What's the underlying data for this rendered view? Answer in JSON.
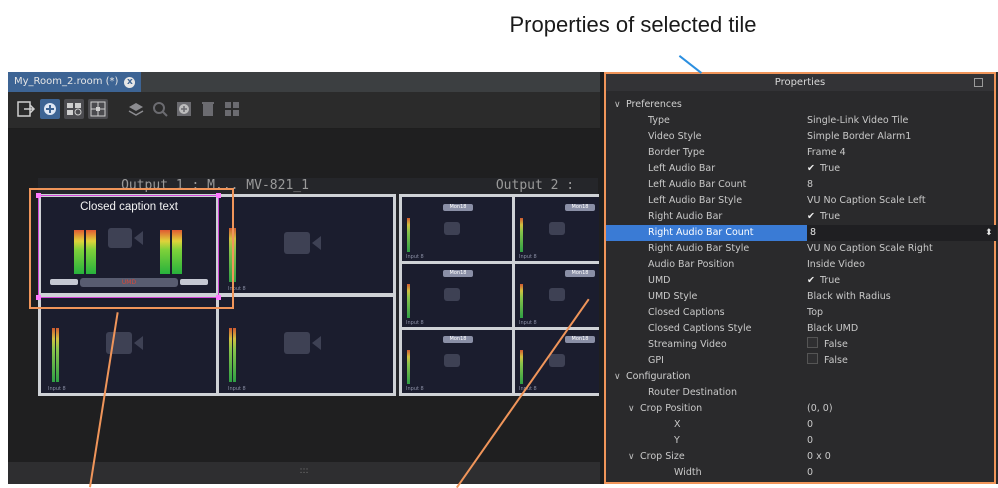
{
  "caption": "Properties of selected tile",
  "tab": {
    "title": "My_Room_2.room (*)",
    "close_glyph": "x"
  },
  "toolbar": {
    "icons": [
      "exit-icon",
      "add-tile-icon",
      "layout-icon",
      "grid-icon",
      "layers-icon",
      "zoom-icon",
      "add-icon",
      "delete-icon",
      "tiles-icon"
    ]
  },
  "canvas": {
    "output1": "Output 1 : M... MV-821_1",
    "output2": "Output 2 :",
    "closed_caption": "Closed caption text",
    "umd_text": "UMD",
    "mon_label": "Mon18",
    "input_label": "Input 8"
  },
  "splitter_glyph": ":::",
  "properties": {
    "title": "Properties",
    "rows": [
      {
        "key": "Preferences",
        "value": "",
        "type": "section"
      },
      {
        "key": "Type",
        "value": "Single-Link Video Tile",
        "type": "prop"
      },
      {
        "key": "Video Style",
        "value": "Simple Border Alarm1",
        "type": "prop"
      },
      {
        "key": "Border Type",
        "value": "Frame 4",
        "type": "prop"
      },
      {
        "key": "Left Audio Bar",
        "value": "True",
        "type": "check"
      },
      {
        "key": "Left Audio Bar Count",
        "value": "8",
        "type": "prop"
      },
      {
        "key": "Left Audio Bar Style",
        "value": "VU No Caption Scale Left",
        "type": "prop"
      },
      {
        "key": "Right Audio Bar",
        "value": "True",
        "type": "check"
      },
      {
        "key": "Right Audio Bar Count",
        "value": "8",
        "type": "selected"
      },
      {
        "key": "Right Audio Bar Style",
        "value": "VU No Caption Scale Right",
        "type": "prop"
      },
      {
        "key": "Audio Bar Position",
        "value": "Inside Video",
        "type": "prop"
      },
      {
        "key": "UMD",
        "value": "True",
        "type": "check"
      },
      {
        "key": "UMD Style",
        "value": "Black with Radius",
        "type": "prop"
      },
      {
        "key": "Closed Captions",
        "value": "Top",
        "type": "prop"
      },
      {
        "key": "Closed Captions Style",
        "value": "Black UMD",
        "type": "prop"
      },
      {
        "key": "Streaming Video",
        "value": "False",
        "type": "uncheck"
      },
      {
        "key": "GPI",
        "value": "False",
        "type": "uncheck"
      },
      {
        "key": "Configuration",
        "value": "",
        "type": "section"
      },
      {
        "key": "Router Destination",
        "value": "",
        "type": "prop"
      },
      {
        "key": "Crop Position",
        "value": "(0, 0)",
        "type": "subsection"
      },
      {
        "key": "X",
        "value": "0",
        "type": "sub"
      },
      {
        "key": "Y",
        "value": "0",
        "type": "sub"
      },
      {
        "key": "Crop Size",
        "value": "0 x 0",
        "type": "subsection"
      },
      {
        "key": "Width",
        "value": "0",
        "type": "sub"
      }
    ]
  },
  "colors": {
    "accent": "#3a7bd5",
    "callout": "#f0955a",
    "selection": "#d247d8"
  }
}
